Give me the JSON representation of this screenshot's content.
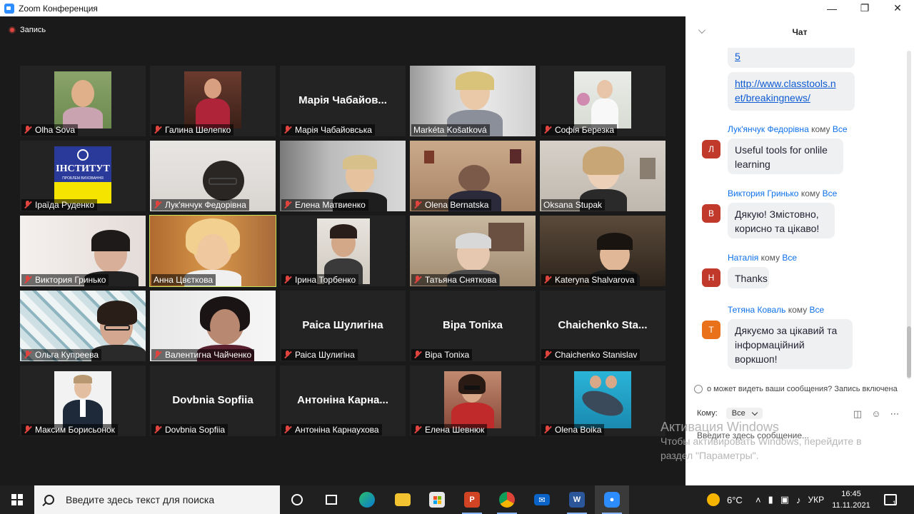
{
  "window": {
    "title": "Zoom Конференция"
  },
  "recording": {
    "label": "Запись"
  },
  "participants": [
    {
      "name": "Olha Sova"
    },
    {
      "name": "Галина Шелепко"
    },
    {
      "name": "Марія Чабайовська",
      "display": "Марія  Чабайов..."
    },
    {
      "name": "Markéta Košatková"
    },
    {
      "name": "Софія Березка"
    },
    {
      "name": "Іраїда Руденко",
      "logo_text": "ІНСТИТУТ",
      "logo_sub": "ПРОБЛЕМ ВИХОВАННЯ"
    },
    {
      "name": "Лук'янчук Федорівна"
    },
    {
      "name": "Елена Матвиенко"
    },
    {
      "name": "Olena Bernatska"
    },
    {
      "name": "Oksana Stupak"
    },
    {
      "name": "Виктория Гринько"
    },
    {
      "name": "Анна Цвєткова",
      "active": true
    },
    {
      "name": "Ірина Торбенко"
    },
    {
      "name": "Татьяна Сняткова"
    },
    {
      "name": "Kateryna Shalvarova"
    },
    {
      "name": "Ольга Купреева"
    },
    {
      "name": "Валентигна Чайченко"
    },
    {
      "name": "Раіса Шулигіна",
      "display": "Раіса Шулигіна"
    },
    {
      "name": "Віра Топіха",
      "display": "Віра Топіха"
    },
    {
      "name": "Chaichenko Stanislav",
      "display": "Chaichenko  Sta..."
    },
    {
      "name": "Максим Борисьонок"
    },
    {
      "name": "Dovbnia Sopfiia",
      "display": "Dovbnia Sopfiia"
    },
    {
      "name": "Антоніна Карнаухова",
      "display": "Антоніна  Карна..."
    },
    {
      "name": "Елена Шевнюк"
    },
    {
      "name": "Olena Boika"
    }
  ],
  "chat": {
    "title": "Чат",
    "top_bubble_tail": "5",
    "link_line1": "http://www.classtools.n",
    "link_line2": "et/breakingnews/",
    "to_word": "кому",
    "to_target": "Все",
    "messages": [
      {
        "sender": "Лук'янчук Федорівна",
        "initial": "Л",
        "color": "#c0392b",
        "line1": "Useful tools for onlile",
        "line2": "learning",
        "line3": ""
      },
      {
        "sender": "Виктория Гринько",
        "initial": "В",
        "color": "#c0392b",
        "line1": "Дякую! Змістовно,",
        "line2": "корисно та цікаво!",
        "line3": ""
      },
      {
        "sender": "Наталія",
        "initial": "Н",
        "color": "#c0392b",
        "line1": "Thanks",
        "line2": "",
        "line3": ""
      },
      {
        "sender": "Тетяна Коваль",
        "initial": "Т",
        "color": "#e8711a",
        "line1": "Дякуємо за цікавий та",
        "line2": "інформаційний",
        "line3": "воркшоп!"
      }
    ],
    "notice": "о может видеть ваши сообщения? Запись включена",
    "to_label": "Кому:",
    "to_select": "Все",
    "input_placeholder": "Введите здесь сообщение..."
  },
  "watermark": {
    "line1": "Активация Windows",
    "line2": "Чтобы активировать Windows, перейдите в",
    "line3": "раздел \"Параметры\"."
  },
  "taskbar": {
    "search_placeholder": "Введите здесь текст для поиска",
    "weather": "6°C",
    "lang": "УКР",
    "time": "16:45",
    "date": "11.11.2021",
    "notification_count": "1"
  }
}
